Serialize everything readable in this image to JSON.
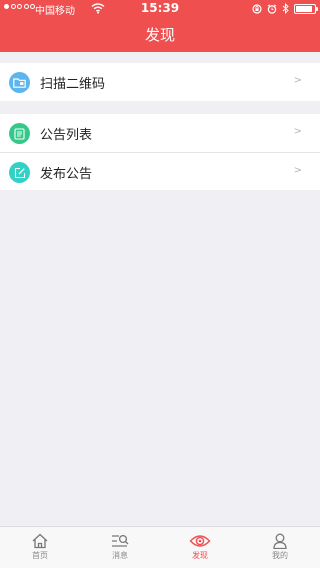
{
  "status_bar": {
    "carrier": "中国移动",
    "time": "15:39"
  },
  "nav": {
    "title": "发现"
  },
  "colors": {
    "brand": "#ef4f4f",
    "scan_icon_bg": "#5bb5ee",
    "list_icon_bg": "#36c889",
    "publish_icon_bg": "#2fd2c4"
  },
  "groups": [
    {
      "items": [
        {
          "label": "扫描二维码",
          "icon": "scan-folder-icon",
          "chevron": ">"
        }
      ]
    },
    {
      "items": [
        {
          "label": "公告列表",
          "icon": "notice-list-icon",
          "chevron": ">"
        },
        {
          "label": "发布公告",
          "icon": "edit-icon",
          "chevron": ">"
        }
      ]
    }
  ],
  "tabbar": {
    "tabs": [
      {
        "label": "首页",
        "icon": "home-icon"
      },
      {
        "label": "消息",
        "icon": "message-search-icon"
      },
      {
        "label": "发现",
        "icon": "eye-icon",
        "active": true
      },
      {
        "label": "我的",
        "icon": "person-icon"
      }
    ]
  }
}
